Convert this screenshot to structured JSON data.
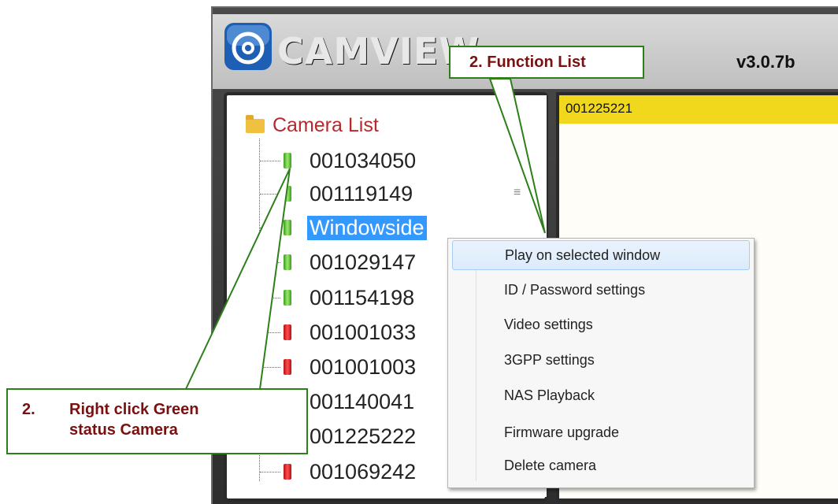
{
  "app": {
    "brand": "CAMVIEW",
    "version": "v3.0.7b"
  },
  "tree": {
    "root_label": "Camera List",
    "items": [
      {
        "label": "001034050",
        "status": "green"
      },
      {
        "label": "001119149",
        "status": "green"
      },
      {
        "label": "Windowside",
        "status": "green",
        "selected": true
      },
      {
        "label": "001029147",
        "status": "green"
      },
      {
        "label": "001154198",
        "status": "green"
      },
      {
        "label": "001001033",
        "status": "red"
      },
      {
        "label": "001001003",
        "status": "red"
      },
      {
        "label": "001140041",
        "status": "red"
      },
      {
        "label": "001225222",
        "status": "red"
      },
      {
        "label": "001069242",
        "status": "red"
      }
    ]
  },
  "video": {
    "camera_id": "001225221"
  },
  "context_menu": {
    "items": [
      "Play on selected window",
      "ID / Password settings",
      "Video settings",
      "3GPP settings",
      "NAS Playback",
      "Firmware upgrade",
      "Delete camera"
    ]
  },
  "callouts": {
    "function_list": "2. Function List",
    "right_click_number": "2.",
    "right_click_line1": "Right click Green",
    "right_click_line2": "status Camera"
  },
  "colors": {
    "status_green": "#3a9d1f",
    "status_red": "#b50f12",
    "selection": "#3399ff",
    "video_bar": "#f2d81c",
    "callout_border": "#2d7f1a",
    "callout_text": "#7a1010"
  }
}
